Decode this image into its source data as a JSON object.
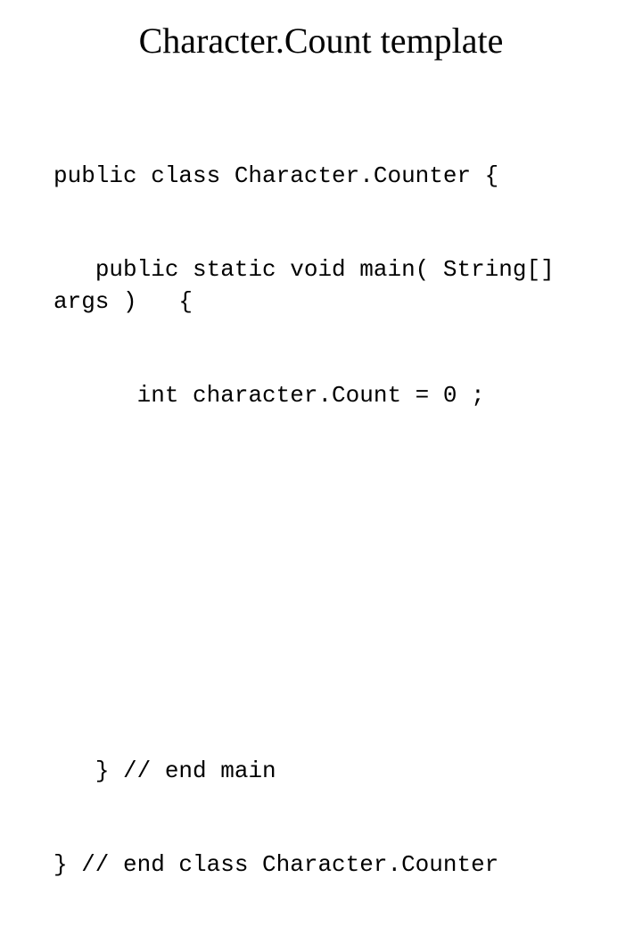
{
  "slide": {
    "title": "Character.Count template",
    "code": {
      "line1": "public class Character.Counter {",
      "line2": "   public static void main( String[] args )   {",
      "line3": "      int character.Count = 0 ;",
      "line4": "   } // end main",
      "line5": "} // end class Character.Counter"
    }
  }
}
